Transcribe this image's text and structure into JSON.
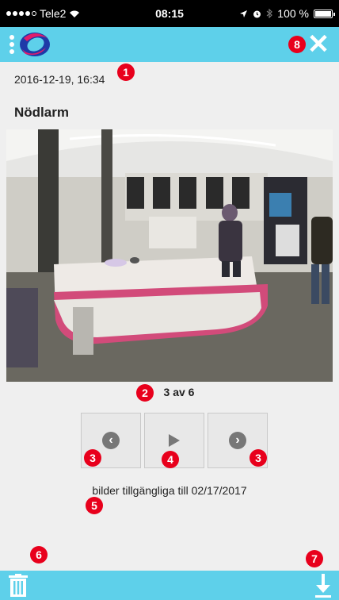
{
  "status_bar": {
    "carrier": "Tele2",
    "time": "08:15",
    "battery": "100 %"
  },
  "header": {
    "logo_icon": "brand-logo-icon",
    "close_label": "✕"
  },
  "alarm": {
    "timestamp": "2016-12-19, 16:34",
    "title": "Nödlarm"
  },
  "viewer": {
    "counter": "3 av 6",
    "prev_icon": "chevron-left-circle-icon",
    "play_icon": "play-icon",
    "next_icon": "chevron-right-circle-icon",
    "availability": "bilder tillgängliga till 02/17/2017"
  },
  "bottom_bar": {
    "delete_icon": "trash-icon",
    "download_icon": "download-icon"
  },
  "markers": [
    "1",
    "2",
    "3",
    "4",
    "3",
    "5",
    "6",
    "7",
    "8"
  ],
  "colors": {
    "accent": "#5ed0ea",
    "marker": "#e8001c",
    "background": "#efefef"
  }
}
